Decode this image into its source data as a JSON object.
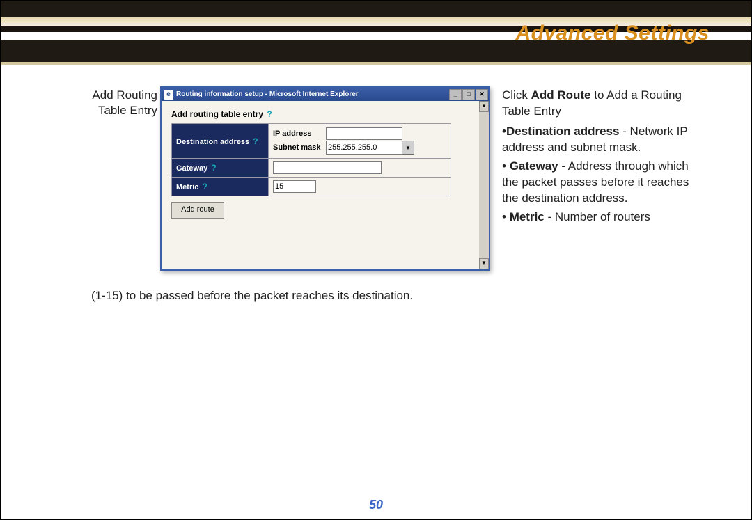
{
  "header": {
    "title": "Advanced Settings"
  },
  "left_caption": {
    "line1": "Add Routing",
    "line2": "Table Entry"
  },
  "window": {
    "title": "Routing information setup - Microsoft Internet Explorer",
    "ie_glyph": "e",
    "form_heading": "Add routing table entry",
    "help_glyph": "?",
    "rows": {
      "dest": {
        "label": "Destination address",
        "ip_label": "IP address",
        "ip_value": "",
        "mask_label": "Subnet mask",
        "mask_value": "255.255.255.0"
      },
      "gateway": {
        "label": "Gateway",
        "value": ""
      },
      "metric": {
        "label": "Metric",
        "value": "15"
      }
    },
    "add_button": "Add route",
    "winbuttons": {
      "min": "_",
      "max": "□",
      "close": "✕"
    },
    "scroll": {
      "up": "▲",
      "down": "▼",
      "drop": "▼"
    }
  },
  "right": {
    "p1_a": "Click ",
    "p1_b": "Add Route",
    "p1_c": " to Add a Routing Table Entry",
    "p2_a": "•",
    "p2_b": "Destination address",
    "p2_c": " - Network IP address and subnet mask.",
    "p3_a": "• ",
    "p3_b": "Gateway",
    "p3_c": " - Address through which the packet passes before it reaches the destination address.",
    "p4_a": "• ",
    "p4_b": "Metric",
    "p4_c": " - Number of routers"
  },
  "bottom": "(1-15) to be passed before the packet reaches its destination.",
  "page_number": "50"
}
